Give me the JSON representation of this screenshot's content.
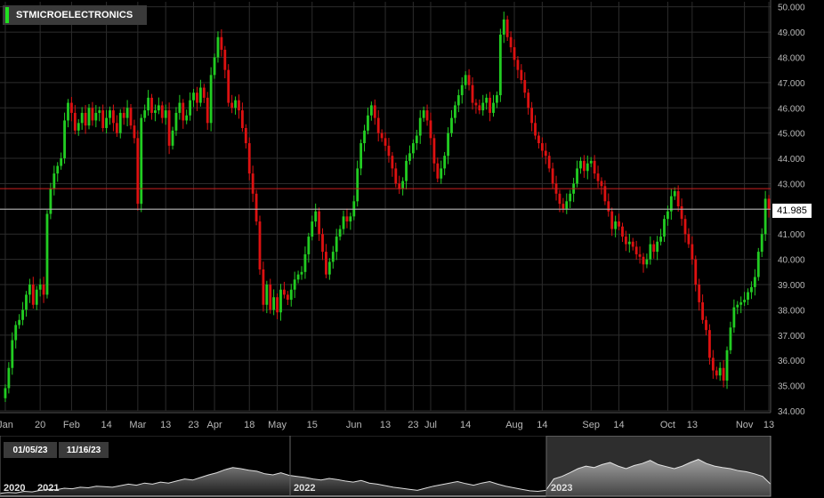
{
  "title": "STMICROELECTRONICS",
  "colors": {
    "up": "#22cc22",
    "down": "#dd1111",
    "grid": "#2c2c2c",
    "resistance": "#cc2222",
    "last": "#bbbbbb"
  },
  "range": {
    "start": "01/05/23",
    "end": "11/16/23"
  },
  "last_price_label": "41.985",
  "navigator_years": [
    "2020",
    "2021",
    "2022",
    "2023"
  ],
  "chart_data": {
    "type": "candlestick",
    "title": "STMICROELECTRONICS",
    "ylim": [
      34.0,
      50.2
    ],
    "y_ticks": [
      "34.000",
      "35.000",
      "36.000",
      "37.000",
      "38.000",
      "39.000",
      "40.000",
      "41.000",
      "42.000",
      "43.000",
      "44.000",
      "45.000",
      "46.000",
      "47.000",
      "48.000",
      "49.000",
      "50.000"
    ],
    "x_ticks": [
      {
        "label": "Jan",
        "idx": 0
      },
      {
        "label": "20",
        "idx": 10
      },
      {
        "label": "Feb",
        "idx": 19
      },
      {
        "label": "14",
        "idx": 29
      },
      {
        "label": "Mar",
        "idx": 38
      },
      {
        "label": "13",
        "idx": 46
      },
      {
        "label": "23",
        "idx": 54
      },
      {
        "label": "Apr",
        "idx": 60
      },
      {
        "label": "18",
        "idx": 70
      },
      {
        "label": "May",
        "idx": 78
      },
      {
        "label": "15",
        "idx": 88
      },
      {
        "label": "Jun",
        "idx": 100
      },
      {
        "label": "13",
        "idx": 109
      },
      {
        "label": "23",
        "idx": 117
      },
      {
        "label": "Jul",
        "idx": 122
      },
      {
        "label": "14",
        "idx": 132
      },
      {
        "label": "Aug",
        "idx": 146
      },
      {
        "label": "14",
        "idx": 154
      },
      {
        "label": "Sep",
        "idx": 168
      },
      {
        "label": "14",
        "idx": 176
      },
      {
        "label": "Oct",
        "idx": 190
      },
      {
        "label": "13",
        "idx": 197
      },
      {
        "label": "Nov",
        "idx": 212
      },
      {
        "label": "13",
        "idx": 219
      }
    ],
    "resistance_level": 42.8,
    "last_price": 41.985,
    "close": [
      34.9,
      35.7,
      36.8,
      37.4,
      37.6,
      38.0,
      38.6,
      39.0,
      38.2,
      38.8,
      39.0,
      38.6,
      41.8,
      42.8,
      43.4,
      43.7,
      44.0,
      45.5,
      46.2,
      45.8,
      45.1,
      45.4,
      45.8,
      45.3,
      46.0,
      45.5,
      45.8,
      45.9,
      45.2,
      45.6,
      45.9,
      45.4,
      45.0,
      45.8,
      45.6,
      46.0,
      45.3,
      44.8,
      42.2,
      45.6,
      45.9,
      46.4,
      45.8,
      45.9,
      46.1,
      45.6,
      45.9,
      44.5,
      45.1,
      45.8,
      46.2,
      45.5,
      45.7,
      46.3,
      46.6,
      46.2,
      46.8,
      46.4,
      45.4,
      47.3,
      48.0,
      48.8,
      48.3,
      47.5,
      46.2,
      46.0,
      46.3,
      45.9,
      45.2,
      44.6,
      43.4,
      42.6,
      41.5,
      39.6,
      38.2,
      39.0,
      38.0,
      38.5,
      37.9,
      38.8,
      38.6,
      38.4,
      38.8,
      39.2,
      39.4,
      39.5,
      40.2,
      40.9,
      41.5,
      41.9,
      41.0,
      40.3,
      39.4,
      39.9,
      40.3,
      40.9,
      41.2,
      41.7,
      41.5,
      41.7,
      42.3,
      43.6,
      44.6,
      45.1,
      45.7,
      46.1,
      45.6,
      45.0,
      44.8,
      44.5,
      44.1,
      43.6,
      43.0,
      42.8,
      43.1,
      43.9,
      44.2,
      44.6,
      44.9,
      45.6,
      45.9,
      45.5,
      44.8,
      43.8,
      43.2,
      43.6,
      44.1,
      45.0,
      45.6,
      46.1,
      46.5,
      46.9,
      47.3,
      46.9,
      46.2,
      46.1,
      45.9,
      46.2,
      46.4,
      45.8,
      46.2,
      46.5,
      48.9,
      49.5,
      48.8,
      48.4,
      47.9,
      47.5,
      47.1,
      46.6,
      46.0,
      45.4,
      44.9,
      44.6,
      44.3,
      44.1,
      43.6,
      43.0,
      42.6,
      42.2,
      42.0,
      42.3,
      42.6,
      43.0,
      43.6,
      43.9,
      43.5,
      43.8,
      43.9,
      43.4,
      43.1,
      42.9,
      42.3,
      41.9,
      41.2,
      41.5,
      41.3,
      40.9,
      40.6,
      40.7,
      40.5,
      40.2,
      40.1,
      39.8,
      40.0,
      40.6,
      40.3,
      40.7,
      40.9,
      41.6,
      41.9,
      42.5,
      42.7,
      42.1,
      41.6,
      41.0,
      40.6,
      40.0,
      39.0,
      38.3,
      37.6,
      37.2,
      36.1,
      35.6,
      35.4,
      35.7,
      35.2,
      36.4,
      37.3,
      38.1,
      38.2,
      38.3,
      38.4,
      38.7,
      38.9,
      39.3,
      40.3,
      41.0,
      42.4,
      41.985
    ],
    "navigator": {
      "type": "area",
      "values": [
        0.02,
        0.04,
        0.03,
        0.06,
        0.05,
        0.08,
        0.1,
        0.09,
        0.12,
        0.11,
        0.14,
        0.13,
        0.16,
        0.15,
        0.14,
        0.17,
        0.2,
        0.18,
        0.22,
        0.2,
        0.24,
        0.22,
        0.26,
        0.3,
        0.28,
        0.33,
        0.38,
        0.42,
        0.48,
        0.52,
        0.5,
        0.47,
        0.45,
        0.4,
        0.38,
        0.42,
        0.37,
        0.35,
        0.33,
        0.3,
        0.28,
        0.31,
        0.29,
        0.26,
        0.24,
        0.27,
        0.22,
        0.2,
        0.17,
        0.14,
        0.12,
        0.1,
        0.08,
        0.12,
        0.16,
        0.19,
        0.22,
        0.25,
        0.21,
        0.18,
        0.22,
        0.25,
        0.2,
        0.16,
        0.13,
        0.1,
        0.07,
        0.06,
        0.08,
        0.3,
        0.35,
        0.42,
        0.5,
        0.55,
        0.52,
        0.58,
        0.62,
        0.55,
        0.5,
        0.56,
        0.6,
        0.66,
        0.58,
        0.54,
        0.5,
        0.55,
        0.62,
        0.68,
        0.6,
        0.55,
        0.52,
        0.5,
        0.46,
        0.44,
        0.4,
        0.35,
        0.2
      ]
    }
  }
}
